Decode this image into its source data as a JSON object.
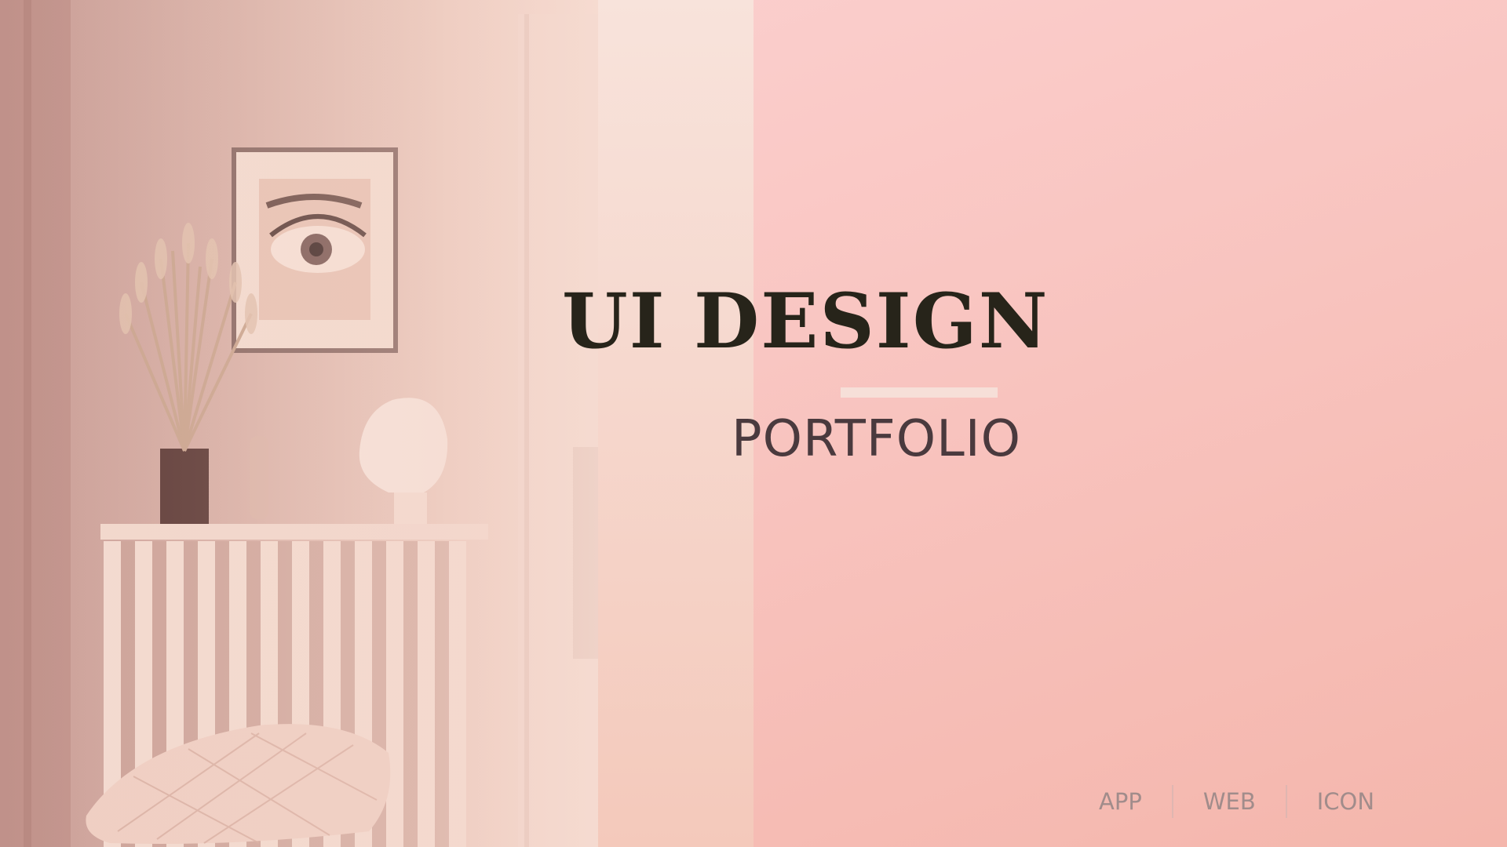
{
  "slide": {
    "title": "UI DESIGN",
    "subtitle": "PORTFOLIO"
  },
  "nav": {
    "items": [
      {
        "label": "APP"
      },
      {
        "label": "WEB"
      },
      {
        "label": "ICON"
      }
    ]
  },
  "colors": {
    "background": "#f9c6c2",
    "title": "#27241a",
    "subtitle": "#4a3a3e",
    "nav_text": "#a18c8b",
    "divider": "#f6dfd8"
  },
  "icons": {
    "photo": "room-interior-illustration"
  }
}
